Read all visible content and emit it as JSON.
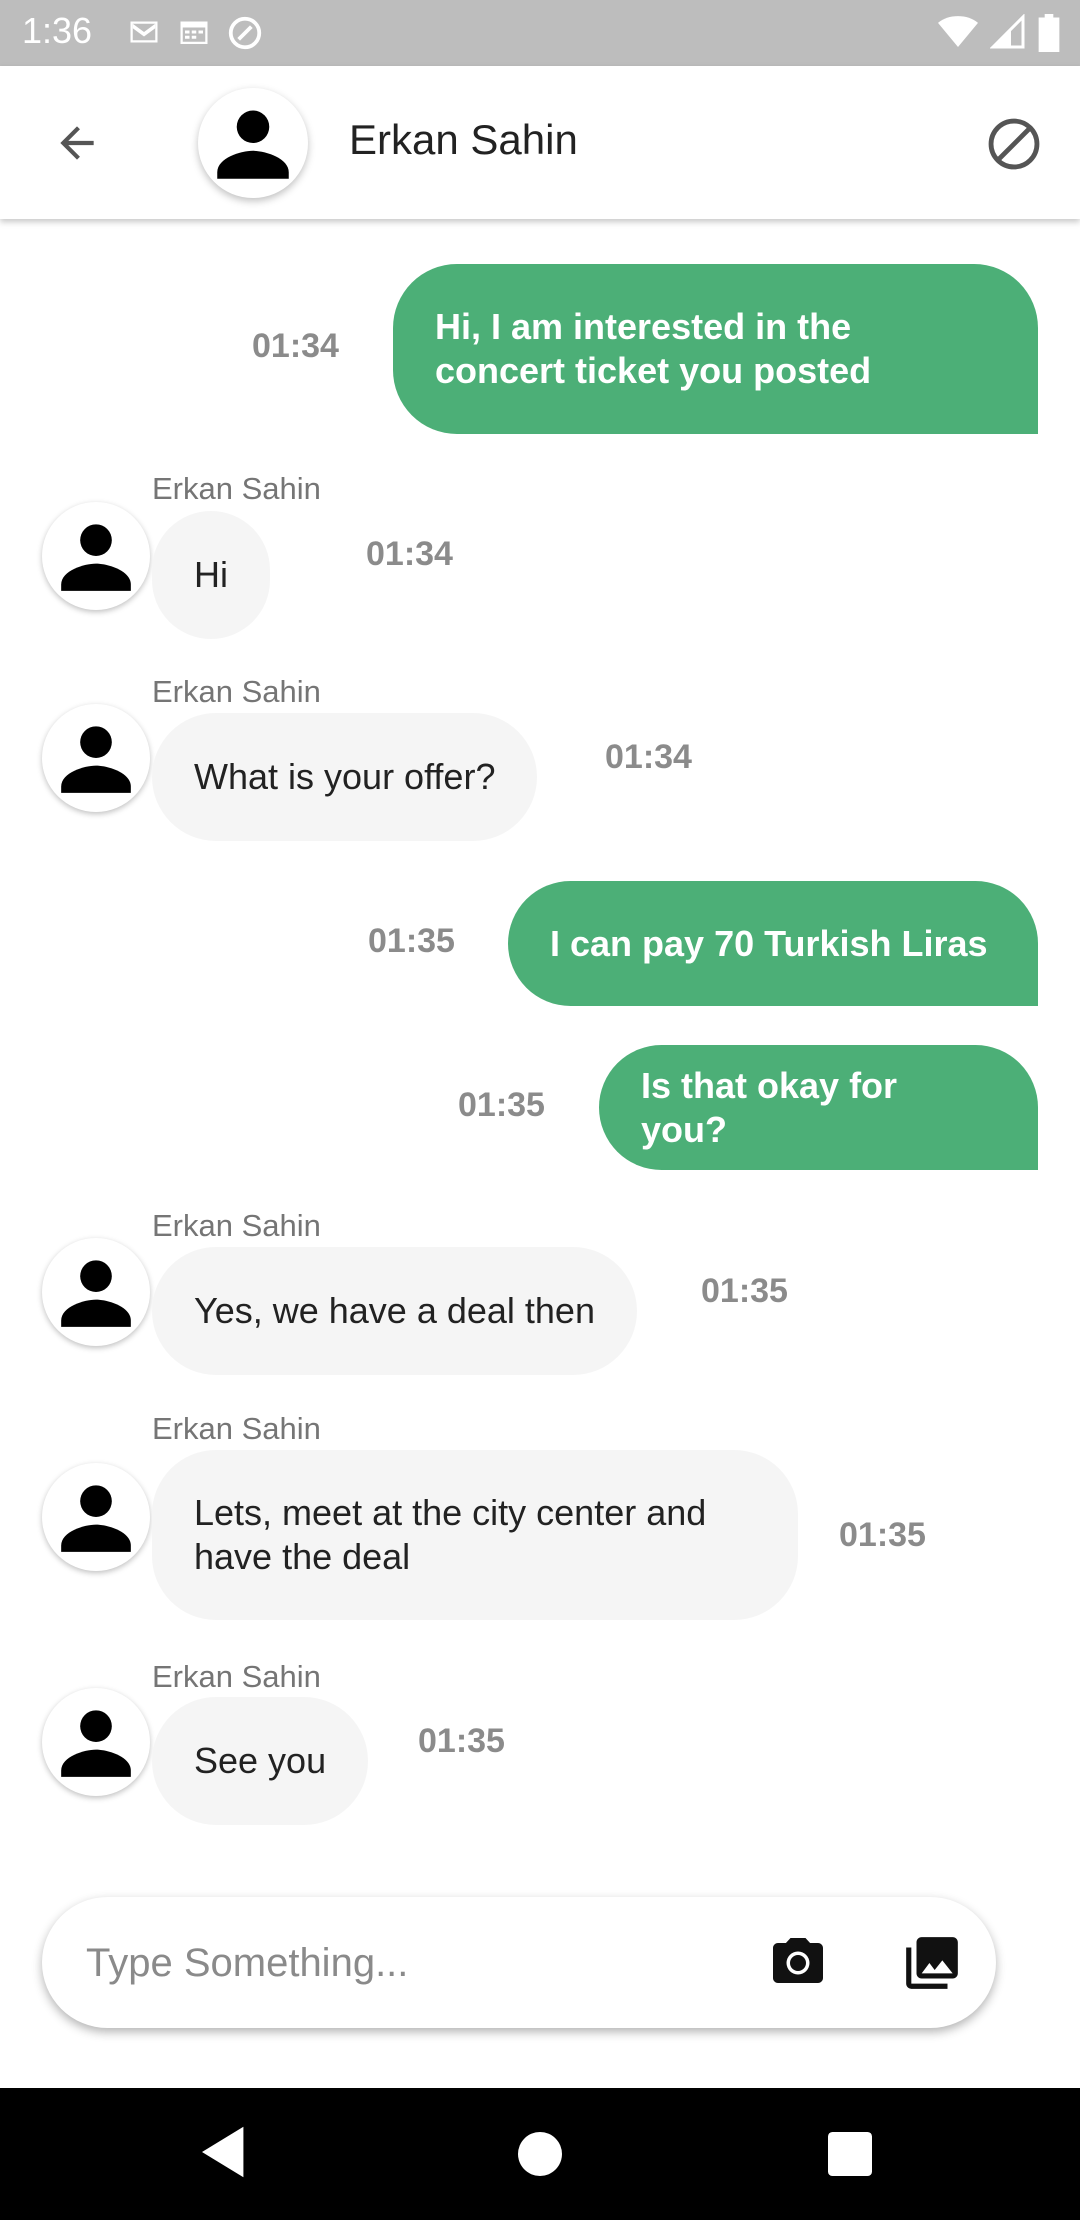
{
  "status_bar": {
    "time": "1:36",
    "icons_left": [
      "gmail-icon",
      "calendar-icon",
      "at-sign-icon"
    ],
    "icons_right": [
      "wifi-icon",
      "signal-icon",
      "battery-icon"
    ]
  },
  "header": {
    "contact_name": "Erkan Sahin",
    "back_icon": "arrow-left-icon",
    "block_icon": "block-icon"
  },
  "messages": [
    {
      "direction": "out",
      "text": "Hi, I am interested in the concert ticket you posted",
      "time": "01:34"
    },
    {
      "direction": "in",
      "sender": "Erkan Sahin",
      "text": "Hi",
      "time": "01:34"
    },
    {
      "direction": "in",
      "sender": "Erkan Sahin",
      "text": "What is your offer?",
      "time": "01:34"
    },
    {
      "direction": "out",
      "text": "I can pay 70 Turkish Liras",
      "time": "01:35"
    },
    {
      "direction": "out",
      "text": "Is that okay for you?",
      "time": "01:35"
    },
    {
      "direction": "in",
      "sender": "Erkan Sahin",
      "text": "Yes, we have a deal then",
      "time": "01:35"
    },
    {
      "direction": "in",
      "sender": "Erkan Sahin",
      "text": "Lets, meet at the city center and have the deal",
      "time": "01:35"
    },
    {
      "direction": "in",
      "sender": "Erkan Sahin",
      "text": "See you",
      "time": "01:35"
    }
  ],
  "composer": {
    "placeholder": "Type Something...",
    "value": "",
    "camera_icon": "camera-icon",
    "gallery_icon": "image-gallery-icon"
  },
  "colors": {
    "outgoing_bubble": "#4caf77",
    "incoming_bubble": "#f5f5f5",
    "status_bar": "#bdbdbd",
    "nav_bar": "#000000"
  }
}
